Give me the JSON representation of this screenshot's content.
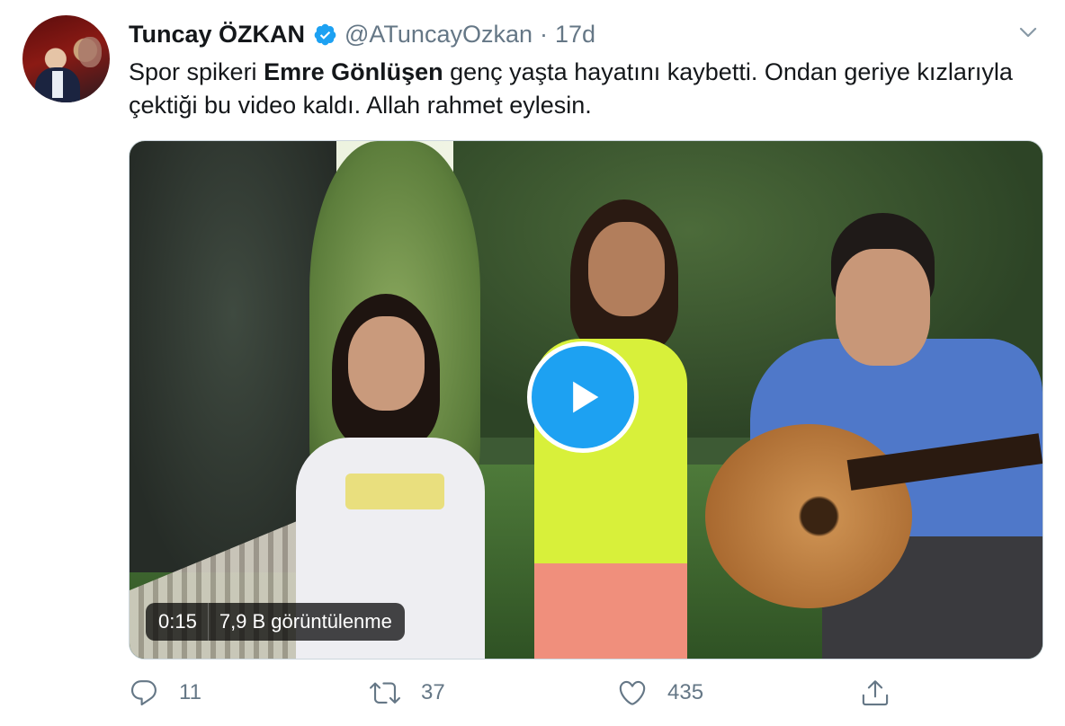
{
  "tweet": {
    "author_name": "Tuncay ÖZKAN",
    "handle": "@ATuncayOzkan",
    "separator": "·",
    "time": "17d",
    "text_pre": "Spor spikeri ",
    "text_bold": "Emre Gönlüşen",
    "text_post": " genç yaşta hayatını kaybetti. Ondan geriye kızlarıyla çektiği bu video kaldı. Allah rahmet eylesin."
  },
  "video": {
    "duration": "0:15",
    "views": "7,9 B görüntülenme"
  },
  "actions": {
    "reply_count": "11",
    "retweet_count": "37",
    "like_count": "435"
  },
  "colors": {
    "accent": "#1da1f2",
    "secondary_text": "#657786",
    "primary_text": "#14171a"
  },
  "icons": {
    "verified": "verified-badge-icon",
    "caret": "chevron-down-icon",
    "play": "play-icon",
    "reply": "reply-icon",
    "retweet": "retweet-icon",
    "like": "heart-icon",
    "share": "share-icon"
  }
}
